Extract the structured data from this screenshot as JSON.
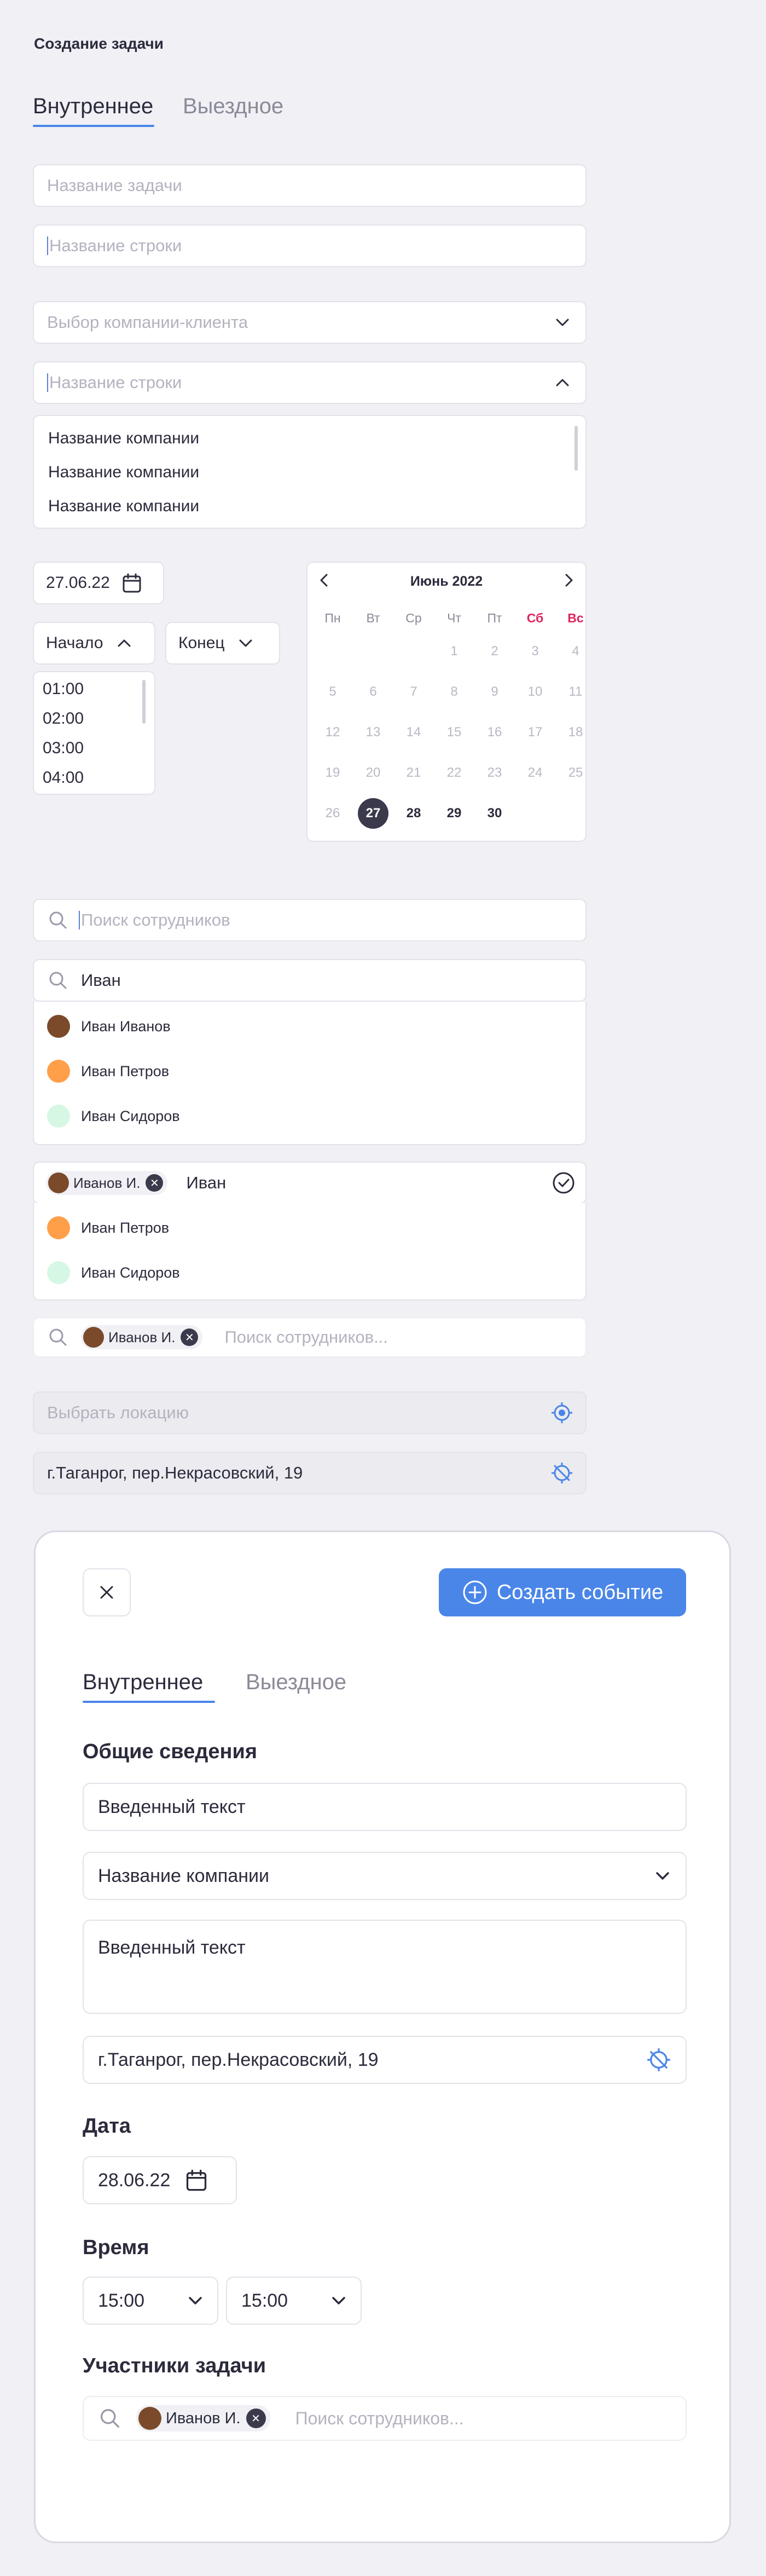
{
  "page": {
    "title": "Создание задачи"
  },
  "tabs": {
    "internal": "Внутреннее",
    "external": "Выездное"
  },
  "fields": {
    "task_name_placeholder": "Название задачи",
    "row_name_placeholder": "Название строки",
    "company_select_placeholder": "Выбор компании-клиента",
    "row_name_placeholder_2": "Название строки"
  },
  "company_dropdown": {
    "items": [
      "Название компании",
      "Название компании",
      "Название компании"
    ]
  },
  "date": {
    "value": "27.06.22"
  },
  "time": {
    "start_label": "Начало",
    "end_label": "Конец",
    "options": [
      "01:00",
      "02:00",
      "03:00",
      "04:00"
    ]
  },
  "calendar": {
    "month": "Июнь 2022",
    "weekdays": [
      "Пн",
      "Вт",
      "Ср",
      "Чт",
      "Пт",
      "Сб",
      "Вс"
    ],
    "weekend_color": "#e0245e",
    "selected_day": "27",
    "rows": [
      [
        "",
        "",
        "",
        "1",
        "2",
        "3",
        "4"
      ],
      [
        "5",
        "6",
        "7",
        "8",
        "9",
        "10",
        "11"
      ],
      [
        "12",
        "13",
        "14",
        "15",
        "16",
        "17",
        "18"
      ],
      [
        "19",
        "20",
        "21",
        "22",
        "23",
        "24",
        "25"
      ],
      [
        "26",
        "27",
        "28",
        "29",
        "30",
        "",
        ""
      ]
    ]
  },
  "employee_search": {
    "placeholder": "Поиск сотрудников",
    "query": "Иван",
    "results": [
      "Иван Иванов",
      "Иван Петров",
      "Иван Сидоров"
    ],
    "selected_chip": "Иванов И.",
    "query_2": "Иван",
    "results_2": [
      "Иван Петров",
      "Иван Сидоров"
    ],
    "chip_3": "Иванов И.",
    "placeholder_3": "Поиск сотрудников..."
  },
  "location": {
    "placeholder": "Выбрать локацию",
    "value": "г.Таганрог, пер.Некрасовский, 19"
  },
  "modal": {
    "create_button": "Создать событие",
    "tab_internal": "Внутреннее",
    "tab_external": "Выездное",
    "general_heading": "Общие сведения",
    "text_value": "Введенный текст",
    "company_value": "Название компании",
    "description_value": "Введенный текст",
    "address_value": "г.Таганрог, пер.Некрасовский, 19",
    "date_heading": "Дата",
    "date_value": "28.06.22",
    "time_heading": "Время",
    "time_start": "15:00",
    "time_end": "15:00",
    "participants_heading": "Участники задачи",
    "participant_chip": "Иванов И.",
    "participants_placeholder": "Поиск сотрудников..."
  },
  "colors": {
    "accent": "#4a86e8",
    "dark": "#3a3a4c",
    "avatar_orange": "#ff9f4a",
    "avatar_mint": "#d6f7e4"
  }
}
